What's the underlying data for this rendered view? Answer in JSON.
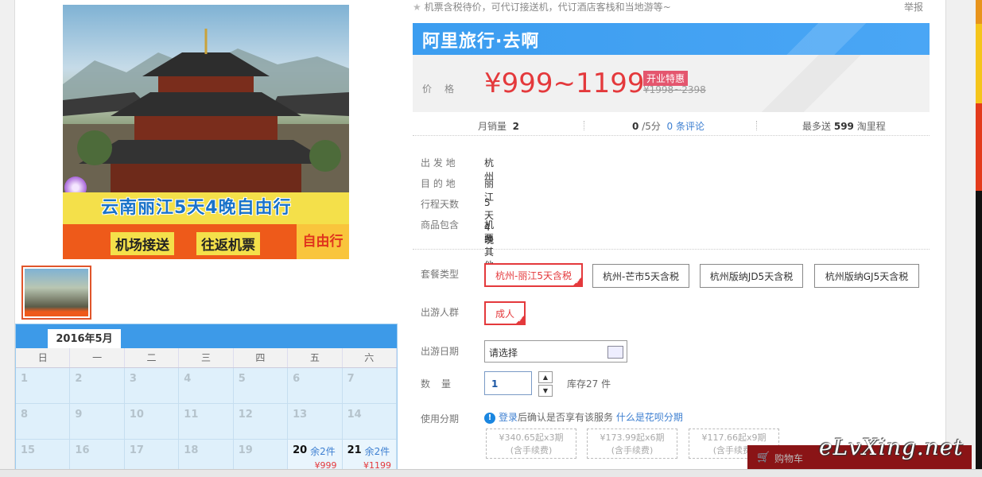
{
  "notice": "机票含税待价，可代订接送机，代订酒店客栈和当地游等~",
  "report": "举报",
  "hero": {
    "title": "云南丽江5天4晚自由行",
    "tags": [
      "机场接送",
      "往返机票"
    ],
    "free": "自由行"
  },
  "calendar": {
    "month": "2016年5月",
    "weekdays": [
      "日",
      "一",
      "二",
      "三",
      "四",
      "五",
      "六"
    ],
    "days": [
      {
        "n": "1"
      },
      {
        "n": "2"
      },
      {
        "n": "3"
      },
      {
        "n": "4"
      },
      {
        "n": "5"
      },
      {
        "n": "6"
      },
      {
        "n": "7"
      },
      {
        "n": "8"
      },
      {
        "n": "9"
      },
      {
        "n": "10"
      },
      {
        "n": "11"
      },
      {
        "n": "12"
      },
      {
        "n": "13"
      },
      {
        "n": "14"
      },
      {
        "n": "15"
      },
      {
        "n": "16"
      },
      {
        "n": "17"
      },
      {
        "n": "18"
      },
      {
        "n": "19"
      },
      {
        "n": "20",
        "left": "余2件",
        "price": "¥999"
      },
      {
        "n": "21",
        "left": "余2件",
        "price": "¥1199"
      }
    ]
  },
  "brand": "阿里旅行·去啊",
  "price": {
    "label": "价格",
    "value": "¥999~1199",
    "badge": "开业特惠",
    "original": "¥1998~2398"
  },
  "stats": {
    "monthly_label": "月销量",
    "monthly_value": "2",
    "score_value": "0",
    "score_suffix": "/5分",
    "reviews": "0 条评论",
    "points_prefix": "最多送",
    "points_value": "599",
    "points_suffix": "淘里程"
  },
  "info": [
    {
      "label": "出 发 地",
      "value": "杭州"
    },
    {
      "label": "目 的 地",
      "value": "丽江"
    },
    {
      "label": "行程天数",
      "value": "5天 4晚"
    },
    {
      "label": "商品包含",
      "value": "机票   其他"
    }
  ],
  "package": {
    "label": "套餐类型",
    "options": [
      "杭州-丽江5天含税",
      "杭州-芒市5天含税",
      "杭州版纳JD5天含税",
      "杭州版纳GJ5天含税"
    ]
  },
  "crowd": {
    "label": "出游人群",
    "option": "成人"
  },
  "date": {
    "label": "出游日期",
    "value": "请选择"
  },
  "quantity": {
    "label": "数量",
    "value": "1",
    "stock": "库存27 件"
  },
  "installment": {
    "label": "使用分期",
    "login": "登录",
    "text": "后确认是否享有该服务",
    "link": "什么是花呗分期",
    "plans": [
      {
        "a": "¥340.65起x3期",
        "b": "(含手续费)"
      },
      {
        "a": "¥173.99起x6期",
        "b": "(含手续费)"
      },
      {
        "a": "¥117.66起x9期",
        "b": "(含手续费)"
      }
    ]
  },
  "cart": {
    "text": "购物车"
  },
  "watermark": "eLvXing.net"
}
